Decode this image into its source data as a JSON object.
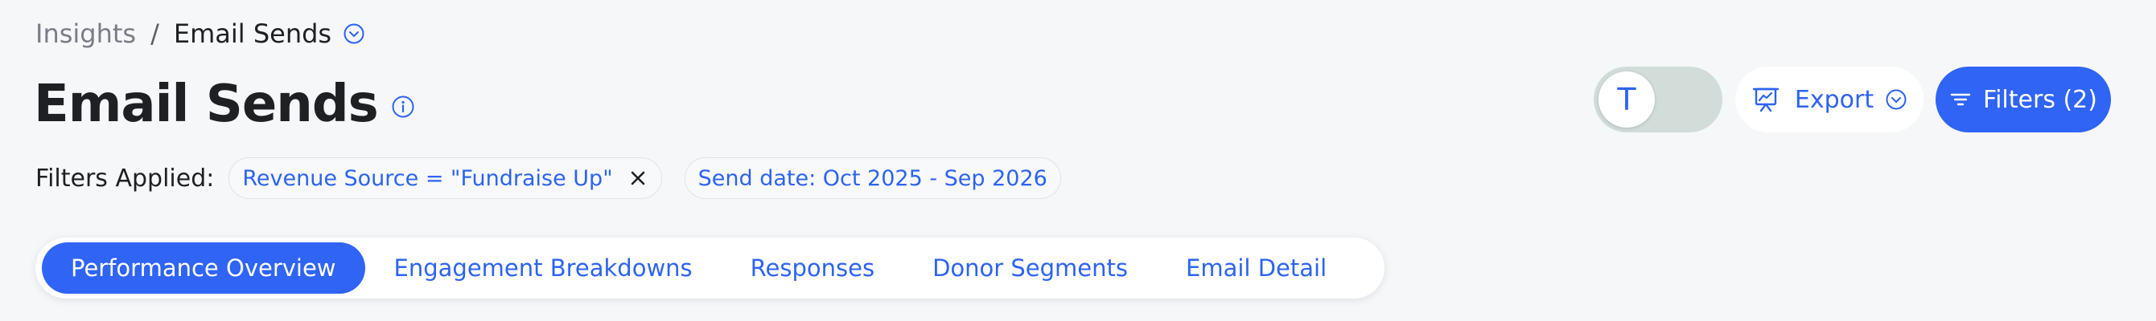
{
  "breadcrumb": {
    "parent": "Insights",
    "separator": "/",
    "current": "Email Sends"
  },
  "header": {
    "title": "Email Sends"
  },
  "filters": {
    "label": "Filters Applied:",
    "chips": [
      {
        "text": "Revenue Source = \"Fundraise Up\"",
        "removable": true
      },
      {
        "text": "Send date: Oct 2025 - Sep 2026",
        "removable": false
      }
    ]
  },
  "tabs": [
    {
      "label": "Performance Overview",
      "active": true
    },
    {
      "label": "Engagement Breakdowns",
      "active": false
    },
    {
      "label": "Responses",
      "active": false
    },
    {
      "label": "Donor Segments",
      "active": false
    },
    {
      "label": "Email Detail",
      "active": false
    }
  ],
  "toolbar": {
    "toggle_initial": "T",
    "export_label": "Export",
    "filters_label": "Filters (2)"
  },
  "icons": {
    "breadcrumb_dropdown": "chevron-down-circle-icon",
    "title_info": "info-icon",
    "chip_remove": "close-icon",
    "export": "presentation-chart-icon",
    "export_dropdown": "chevron-down-circle-icon",
    "filters": "filter-lines-icon"
  },
  "colors": {
    "accent": "#2f64f5",
    "link": "#2c63f2",
    "background": "#f6f7f9",
    "toggle_track": "#d2dcd9"
  }
}
